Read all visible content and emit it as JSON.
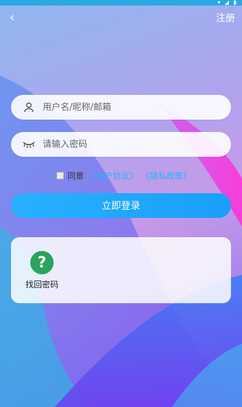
{
  "header": {
    "back_icon": "chevron-left-icon",
    "register_label": "注册"
  },
  "status_bar": {
    "icons": [
      "wifi-icon",
      "signal-icon",
      "battery-icon"
    ]
  },
  "form": {
    "username_placeholder": "用户名/昵称/邮箱",
    "password_placeholder": "请输入密码",
    "username_icon": "user-icon",
    "password_icon": "eye-closed-icon"
  },
  "agreement": {
    "label": "同意",
    "user_agreement": "《用户协议》",
    "privacy_policy": "《隐私政策》"
  },
  "login": {
    "label": "立即登录"
  },
  "extras": {
    "recover_label": "找回密码",
    "recover_icon_text": "?",
    "recover_color": "#29a35d"
  },
  "colors": {
    "accent": "#23b3ff",
    "status_bar": "#2aa9e0"
  }
}
